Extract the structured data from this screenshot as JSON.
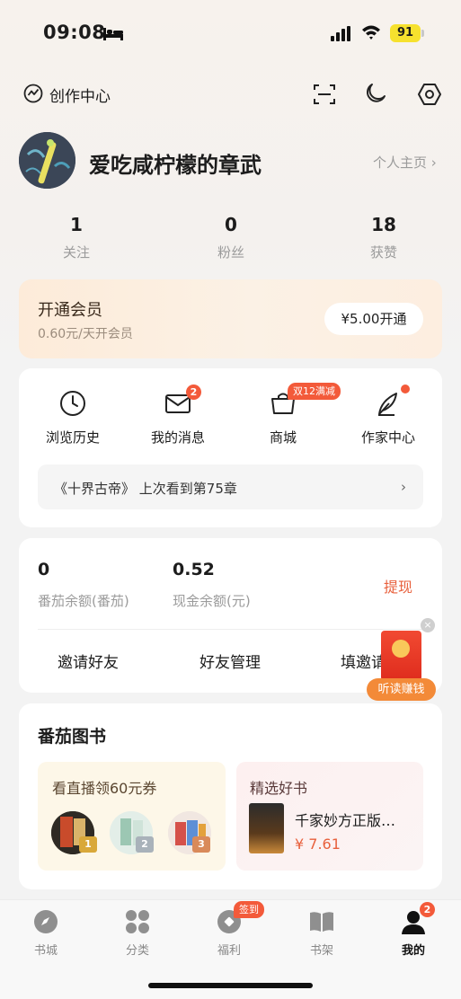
{
  "status_bar": {
    "time": "09:08",
    "battery": "91"
  },
  "header": {
    "creator_label": "创作中心"
  },
  "profile": {
    "username": "爱吃咸柠檬的章武",
    "profile_link": "个人主页 ›"
  },
  "stats": [
    {
      "value": "1",
      "label": "关注"
    },
    {
      "value": "0",
      "label": "粉丝"
    },
    {
      "value": "18",
      "label": "获赞"
    }
  ],
  "vip": {
    "title": "开通会员",
    "subtitle": "0.60元/天开会员",
    "button": "¥5.00开通"
  },
  "shortcuts": [
    {
      "label": "浏览历史",
      "icon": "clock-icon"
    },
    {
      "label": "我的消息",
      "icon": "mail-icon",
      "badge": "2"
    },
    {
      "label": "商城",
      "icon": "shop-bag-icon",
      "badge": "双12满减"
    },
    {
      "label": "作家中心",
      "icon": "quill-icon",
      "dot": true
    }
  ],
  "history": {
    "text": "《十界古帝》 上次看到第75章",
    "arrow": "›"
  },
  "wallet": {
    "coins_value": "0",
    "coins_label": "番茄余额(番茄)",
    "cash_value": "0.52",
    "cash_label": "现金余额(元)",
    "withdraw": "提现"
  },
  "actions": [
    "邀请好友",
    "好友管理",
    "填邀请"
  ],
  "floating": {
    "label": "听读赚钱",
    "close": "×"
  },
  "books": {
    "title": "番茄图书",
    "live": {
      "title": "看直播领60元券",
      "ranks": [
        "1",
        "2",
        "3"
      ]
    },
    "pick": {
      "title": "精选好书",
      "book_name": "千家妙方正版…",
      "price": "¥ 7.61"
    }
  },
  "tabbar": {
    "items": [
      {
        "label": "书城",
        "icon": "compass-icon"
      },
      {
        "label": "分类",
        "icon": "grid-icon"
      },
      {
        "label": "福利",
        "icon": "gift-icon",
        "badge": "签到"
      },
      {
        "label": "书架",
        "icon": "book-icon"
      },
      {
        "label": "我的",
        "icon": "person-icon",
        "badge": "2",
        "active": true
      }
    ]
  },
  "colors": {
    "accent": "#e8603c",
    "badge": "#f35a3a",
    "vip_bg": "#fdebd9"
  }
}
